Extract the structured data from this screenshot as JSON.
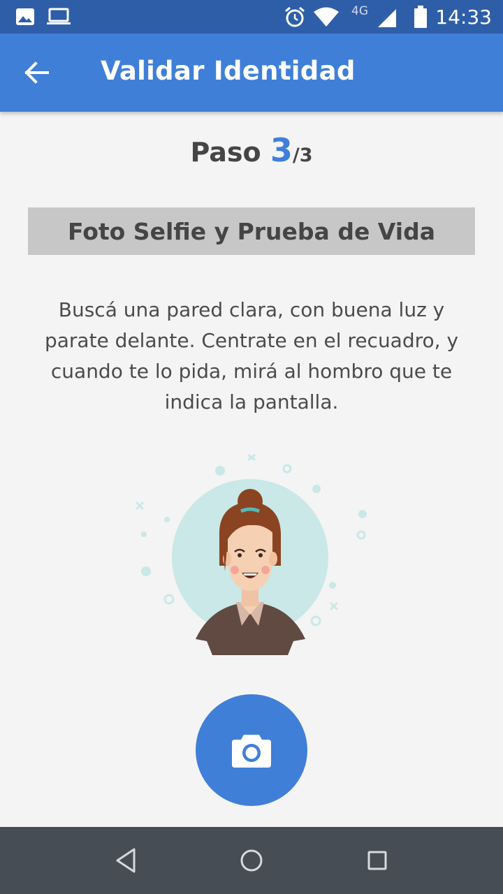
{
  "status_bar": {
    "time": "14:33",
    "network": "4G",
    "icons": [
      "image-icon",
      "laptop-icon",
      "alarm-icon",
      "wifi-icon",
      "signal-icon",
      "battery-icon"
    ]
  },
  "app_bar": {
    "title": "Validar Identidad",
    "back_icon": "arrow-left-icon"
  },
  "step": {
    "label": "Paso ",
    "current": "3",
    "total": "/3"
  },
  "section": {
    "title": "Foto Selfie y Prueba de Vida"
  },
  "instructions": {
    "text": "Buscá una pared clara, con buena luz y parate delante. Centrate en el recuadro, y cuando te lo pida, mirá al hombro que te indica la pantalla."
  },
  "illustration": {
    "icon": "selfie-woman-illustration"
  },
  "camera_button": {
    "icon": "camera-icon"
  },
  "nav_bar": {
    "buttons": [
      "back-triangle-icon",
      "home-circle-icon",
      "recents-square-icon"
    ]
  },
  "colors": {
    "status_bar": "#2f5ea9",
    "app_bar": "#3f7fd8",
    "accent": "#3f7fd8",
    "section_bg": "#c7c7c7",
    "nav_bar": "#474d54",
    "background": "#f4f4f4"
  }
}
